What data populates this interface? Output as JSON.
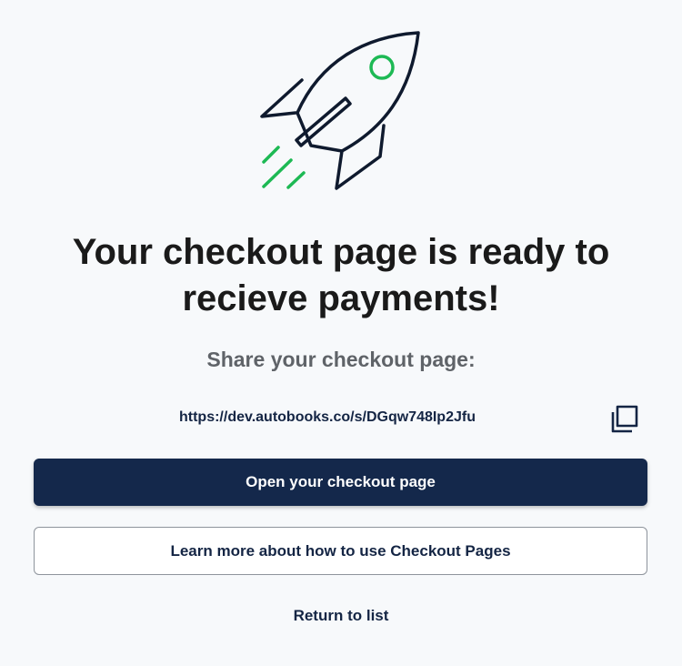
{
  "title": "Your checkout page is ready to recieve payments!",
  "share_label": "Share your checkout page:",
  "checkout_url": "https://dev.autobooks.co/s/DGqw748Ip2Jfu",
  "icons": {
    "hero": "rocket-icon",
    "copy": "copy-icon"
  },
  "buttons": {
    "open_label": "Open your checkout page",
    "learn_more_label": "Learn more about how to use Checkout Pages"
  },
  "return_label": "Return to list",
  "colors": {
    "primary": "#14284b",
    "accent_green": "#1db954",
    "background": "#f7f9fb",
    "title_text": "#1a1a1a"
  }
}
